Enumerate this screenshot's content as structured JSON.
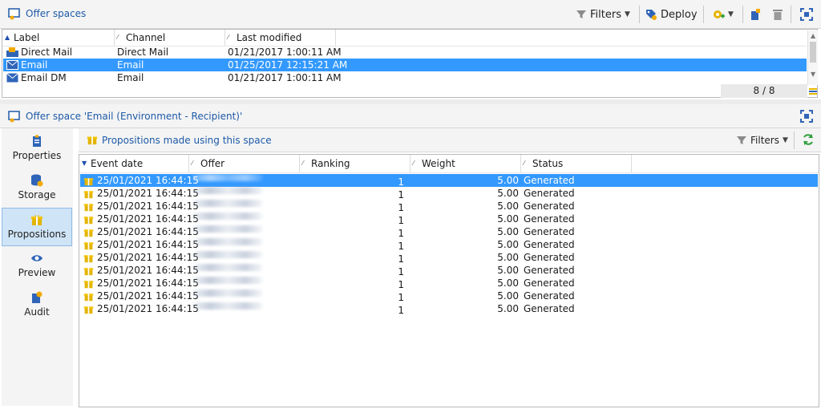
{
  "top": {
    "title": "Offer spaces",
    "toolbar": {
      "filters": "Filters",
      "deploy": "Deploy"
    },
    "columns": [
      "Label",
      "Channel",
      "Last modified"
    ],
    "rows": [
      {
        "icon": "direct-mail-icon",
        "label": "Direct Mail",
        "channel": "Direct Mail",
        "modified": "01/21/2017 1:00:11 AM"
      },
      {
        "icon": "email-icon",
        "label": "Email",
        "channel": "Email",
        "modified": "01/25/2017 12:15:21 AM"
      },
      {
        "icon": "email-icon",
        "label": "Email DM",
        "channel": "Email",
        "modified": "01/21/2017 1:00:11 AM"
      }
    ],
    "count": "8 / 8"
  },
  "detail": {
    "title": "Offer space 'Email (Environment - Recipient)'",
    "sidebar": [
      "Properties",
      "Storage",
      "Propositions",
      "Preview",
      "Audit"
    ],
    "section_title": "Propositions made using this space",
    "filters": "Filters",
    "columns": [
      "Event date",
      "Offer",
      "Ranking",
      "Weight",
      "Status"
    ],
    "rows": [
      {
        "date": "25/01/2021 16:44:15",
        "ranking": "1",
        "weight": "5.00",
        "status": "Generated"
      },
      {
        "date": "25/01/2021 16:44:15",
        "ranking": "1",
        "weight": "5.00",
        "status": "Generated"
      },
      {
        "date": "25/01/2021 16:44:15",
        "ranking": "1",
        "weight": "5.00",
        "status": "Generated"
      },
      {
        "date": "25/01/2021 16:44:15",
        "ranking": "1",
        "weight": "5.00",
        "status": "Generated"
      },
      {
        "date": "25/01/2021 16:44:15",
        "ranking": "1",
        "weight": "5.00",
        "status": "Generated"
      },
      {
        "date": "25/01/2021 16:44:15",
        "ranking": "1",
        "weight": "5.00",
        "status": "Generated"
      },
      {
        "date": "25/01/2021 16:44:15",
        "ranking": "1",
        "weight": "5.00",
        "status": "Generated"
      },
      {
        "date": "25/01/2021 16:44:15",
        "ranking": "1",
        "weight": "5.00",
        "status": "Generated"
      },
      {
        "date": "25/01/2021 16:44:15",
        "ranking": "1",
        "weight": "5.00",
        "status": "Generated"
      },
      {
        "date": "25/01/2021 16:44:15",
        "ranking": "1",
        "weight": "5.00",
        "status": "Generated"
      },
      {
        "date": "25/01/2021 16:44:15",
        "ranking": "1",
        "weight": "5.00",
        "status": "Generated"
      }
    ]
  }
}
